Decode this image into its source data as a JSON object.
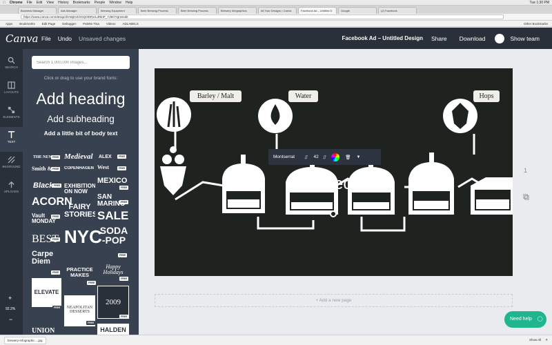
{
  "macbar": {
    "items": [
      "Chrome",
      "File",
      "Edit",
      "View",
      "History",
      "Bookmarks",
      "People",
      "Window",
      "Help"
    ],
    "clock": "Tue 1:30 PM"
  },
  "tabs": [
    "Business Manager",
    "Ads Manager",
    "Brewing Equipment",
    "Beer Brewing Process",
    "Beer Brewing Process",
    "Brewery Infographics",
    "All Your Designs • Canva",
    "Facebook Ad – Untitled D",
    "Google",
    "(2) Facebook"
  ],
  "address": {
    "url": "https://www.canva.com/design/DABjtm4OOQ/3DRxrLdNkIP_Yd6OYgrw/edit"
  },
  "bookmarks": [
    "Apps",
    "Bookmarks",
    "Edit Page",
    "Debugger",
    "Palette Tina",
    "Videos",
    "ADLABELS"
  ],
  "bookmarks_other": "Other Bookmarks",
  "topbar": {
    "logo": "Canva",
    "file": "File",
    "undo": "Undo",
    "status": "Unsaved changes",
    "title": "Facebook Ad – Untitled Design",
    "share": "Share",
    "download": "Download",
    "show_team": "Show team"
  },
  "rail": [
    {
      "label": "SEARCH"
    },
    {
      "label": "LAYOUTS"
    },
    {
      "label": "ELEMENTS"
    },
    {
      "label": "TEXT"
    },
    {
      "label": "BKGROUND"
    },
    {
      "label": "UPLOADS"
    }
  ],
  "panel": {
    "search_placeholder": "Search 1,000,000 images...",
    "hint": "Click or drag to use your brand fonts:",
    "heading": "Add heading",
    "subheading": "Add subheading",
    "body": "Add a little bit of body text",
    "free_badge": "FREE",
    "templates": {
      "t1": "THE NEW",
      "t2": "Medieval",
      "t3": "ALEX",
      "t4": "Smith &",
      "t5": "COPENHAGEN",
      "t6": "West",
      "t7": "Black",
      "t8": "EXHIBITION ON NOW",
      "t9": "MEXICO",
      "t10": "ACORN",
      "t11": "SAN MARINO",
      "t12": "Vault MONDAY",
      "t13": "FAIRY STORIES",
      "t14": "SALE",
      "t15": "BEST",
      "t16": "NYC",
      "t17": "SODA -POP",
      "t18": "Carpe Diem",
      "t19": "PRACTICE MAKES",
      "t20": "Happy Holidays",
      "t21": "ELEVATE",
      "t22": "NEAPOLITAN DESSERTS",
      "t23": "2009",
      "t24": "UNION",
      "t25": "HALDEN"
    }
  },
  "zoom": {
    "plus": "+",
    "value": "92.2%",
    "minus": "−"
  },
  "canvas": {
    "labels": {
      "barley": "Barley / Malt",
      "water": "Water",
      "hops": "Hops"
    },
    "text": "The Secret"
  },
  "text_toolbar": {
    "font": "Montserrat",
    "size": "42"
  },
  "workspace": {
    "add_page": "+ Add a new page",
    "page_number": "1"
  },
  "help": {
    "label": "Need help"
  },
  "downloads": {
    "file": "brewery-infographic....jpg",
    "show_all": "Show All"
  },
  "colors": {
    "topbar": "#293039",
    "panel": "#384150",
    "help": "#1fb58f",
    "canvas_bg": "#1e231f"
  }
}
